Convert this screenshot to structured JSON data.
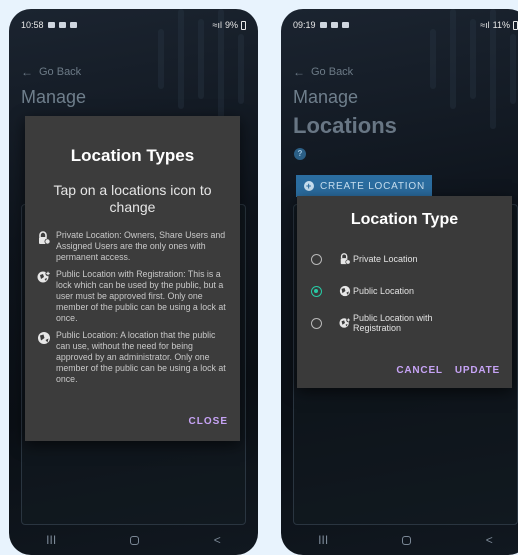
{
  "left_screen": {
    "status": {
      "time": "10:58",
      "battery": "9%"
    },
    "back_label": "Go Back",
    "manage_label": "Manage",
    "nav": {
      "recents": "III",
      "back": "<"
    },
    "dialog": {
      "title": "Location Types",
      "subtitle": "Tap on a locations icon to change",
      "items": [
        {
          "icon": "private-lock-icon",
          "text": "Private Location: Owners, Share Users and Assigned Users are the only ones with permanent access."
        },
        {
          "icon": "public-registration-icon",
          "text": "Public Location with Registration: This is a lock which can be used by the public, but a user must be approved first. Only one member of the public can be using a lock at once."
        },
        {
          "icon": "public-globe-icon",
          "text": "Public Location: A location that the public can use, without the need for being approved by an administrator. Only one member of the public can be using a lock at once."
        }
      ],
      "close_label": "CLOSE"
    }
  },
  "right_screen": {
    "status": {
      "time": "09:19",
      "battery": "11%"
    },
    "back_label": "Go Back",
    "manage_label": "Manage",
    "locations_title": "Locations",
    "create_label": "CREATE LOCATION",
    "nav": {
      "recents": "III",
      "back": "<"
    },
    "dialog": {
      "title": "Location Type",
      "options": [
        {
          "label": "Private Location",
          "icon": "private-lock-icon",
          "selected": false
        },
        {
          "label": "Public Location",
          "icon": "public-globe-icon",
          "selected": true
        },
        {
          "label": "Public Location with Registration",
          "icon": "public-registration-icon",
          "selected": false
        }
      ],
      "cancel_label": "CANCEL",
      "update_label": "UPDATE"
    }
  },
  "colors": {
    "accent_purple": "#c6a3f5",
    "radio_selected": "#28c9a4",
    "create_button": "#2b6da0",
    "dialog_bg": "#3c3c3c"
  }
}
